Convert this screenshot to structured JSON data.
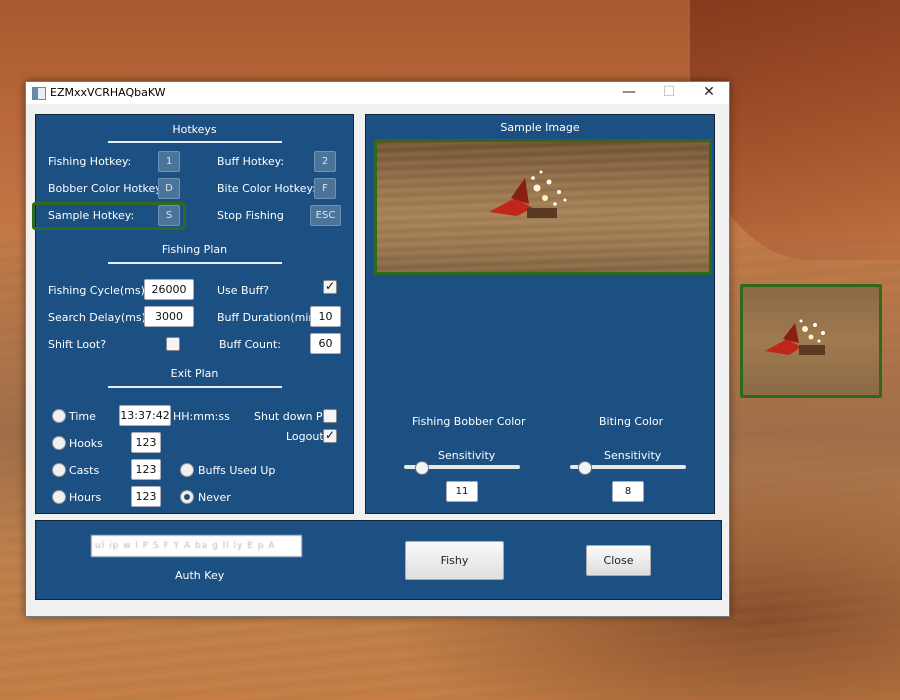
{
  "window": {
    "title": "EZMxxVCRHAQbaKW",
    "minimize": "—",
    "maximize": "☐",
    "close": "✕"
  },
  "hotkeys": {
    "section_title": "Hotkeys",
    "fishing_label": "Fishing Hotkey:",
    "fishing_key": "1",
    "buff_label": "Buff Hotkey:",
    "buff_key": "2",
    "bobber_label": "Bobber Color Hotkey:",
    "bobber_key": "D",
    "bite_label": "Bite Color Hotkey:",
    "bite_key": "F",
    "sample_label": "Sample Hotkey:",
    "sample_key": "S",
    "stop_label": "Stop Fishing",
    "stop_key": "ESC"
  },
  "fishing_plan": {
    "section_title": "Fishing Plan",
    "cycle_label": "Fishing Cycle(ms):",
    "cycle_value": "26000",
    "use_buff_label": "Use Buff?",
    "use_buff_checked": true,
    "search_delay_label": "Search Delay(ms):",
    "search_delay_value": "3000",
    "buff_duration_label": "Buff Duration(min):",
    "buff_duration_value": "10",
    "shift_loot_label": "Shift Loot?",
    "shift_loot_checked": false,
    "buff_count_label": "Buff Count:",
    "buff_count_value": "60"
  },
  "exit_plan": {
    "section_title": "Exit Plan",
    "time_label": "Time",
    "time_value": "13:37:42",
    "time_format": "HH:mm:ss",
    "shutdown_label": "Shut down PC",
    "shutdown_checked": false,
    "logout_label": "Logout",
    "logout_checked": true,
    "hooks_label": "Hooks",
    "hooks_value": "123",
    "casts_label": "Casts",
    "casts_value": "123",
    "buffs_used_label": "Buffs Used Up",
    "hours_label": "Hours",
    "hours_value": "123",
    "never_label": "Never",
    "selected": "Never"
  },
  "sample": {
    "title": "Sample Image",
    "bobber_color_label": "Fishing Bobber Color",
    "biting_color_label": "Biting Color",
    "bobber_sensitivity_label": "Sensitivity",
    "bobber_sensitivity_value": "11",
    "bobber_sensitivity_fraction": 0.11,
    "biting_sensitivity_label": "Sensitivity",
    "biting_sensitivity_value": "8",
    "biting_sensitivity_fraction": 0.08
  },
  "bottom": {
    "auth_key_value": "ul ip w l P S F Y A ba g ll ly E p A",
    "auth_key_label": "Auth Key",
    "fishy_button": "Fishy",
    "close_button": "Close"
  },
  "colors": {
    "panel": "#1c4f82",
    "highlight": "#2e6a1e"
  }
}
